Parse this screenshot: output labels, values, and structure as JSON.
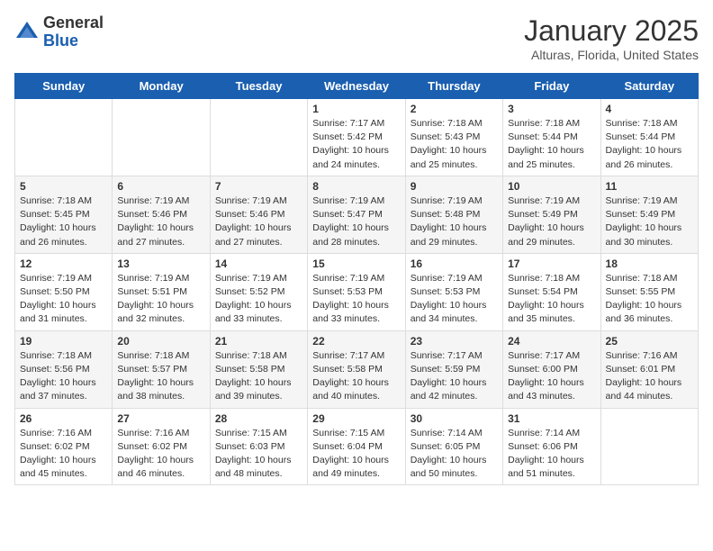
{
  "header": {
    "logo_general": "General",
    "logo_blue": "Blue",
    "title": "January 2025",
    "subtitle": "Alturas, Florida, United States"
  },
  "weekdays": [
    "Sunday",
    "Monday",
    "Tuesday",
    "Wednesday",
    "Thursday",
    "Friday",
    "Saturday"
  ],
  "weeks": [
    [
      {
        "day": "",
        "sunrise": "",
        "sunset": "",
        "daylight": ""
      },
      {
        "day": "",
        "sunrise": "",
        "sunset": "",
        "daylight": ""
      },
      {
        "day": "",
        "sunrise": "",
        "sunset": "",
        "daylight": ""
      },
      {
        "day": "1",
        "sunrise": "Sunrise: 7:17 AM",
        "sunset": "Sunset: 5:42 PM",
        "daylight": "Daylight: 10 hours and 24 minutes."
      },
      {
        "day": "2",
        "sunrise": "Sunrise: 7:18 AM",
        "sunset": "Sunset: 5:43 PM",
        "daylight": "Daylight: 10 hours and 25 minutes."
      },
      {
        "day": "3",
        "sunrise": "Sunrise: 7:18 AM",
        "sunset": "Sunset: 5:44 PM",
        "daylight": "Daylight: 10 hours and 25 minutes."
      },
      {
        "day": "4",
        "sunrise": "Sunrise: 7:18 AM",
        "sunset": "Sunset: 5:44 PM",
        "daylight": "Daylight: 10 hours and 26 minutes."
      }
    ],
    [
      {
        "day": "5",
        "sunrise": "Sunrise: 7:18 AM",
        "sunset": "Sunset: 5:45 PM",
        "daylight": "Daylight: 10 hours and 26 minutes."
      },
      {
        "day": "6",
        "sunrise": "Sunrise: 7:19 AM",
        "sunset": "Sunset: 5:46 PM",
        "daylight": "Daylight: 10 hours and 27 minutes."
      },
      {
        "day": "7",
        "sunrise": "Sunrise: 7:19 AM",
        "sunset": "Sunset: 5:46 PM",
        "daylight": "Daylight: 10 hours and 27 minutes."
      },
      {
        "day": "8",
        "sunrise": "Sunrise: 7:19 AM",
        "sunset": "Sunset: 5:47 PM",
        "daylight": "Daylight: 10 hours and 28 minutes."
      },
      {
        "day": "9",
        "sunrise": "Sunrise: 7:19 AM",
        "sunset": "Sunset: 5:48 PM",
        "daylight": "Daylight: 10 hours and 29 minutes."
      },
      {
        "day": "10",
        "sunrise": "Sunrise: 7:19 AM",
        "sunset": "Sunset: 5:49 PM",
        "daylight": "Daylight: 10 hours and 29 minutes."
      },
      {
        "day": "11",
        "sunrise": "Sunrise: 7:19 AM",
        "sunset": "Sunset: 5:49 PM",
        "daylight": "Daylight: 10 hours and 30 minutes."
      }
    ],
    [
      {
        "day": "12",
        "sunrise": "Sunrise: 7:19 AM",
        "sunset": "Sunset: 5:50 PM",
        "daylight": "Daylight: 10 hours and 31 minutes."
      },
      {
        "day": "13",
        "sunrise": "Sunrise: 7:19 AM",
        "sunset": "Sunset: 5:51 PM",
        "daylight": "Daylight: 10 hours and 32 minutes."
      },
      {
        "day": "14",
        "sunrise": "Sunrise: 7:19 AM",
        "sunset": "Sunset: 5:52 PM",
        "daylight": "Daylight: 10 hours and 33 minutes."
      },
      {
        "day": "15",
        "sunrise": "Sunrise: 7:19 AM",
        "sunset": "Sunset: 5:53 PM",
        "daylight": "Daylight: 10 hours and 33 minutes."
      },
      {
        "day": "16",
        "sunrise": "Sunrise: 7:19 AM",
        "sunset": "Sunset: 5:53 PM",
        "daylight": "Daylight: 10 hours and 34 minutes."
      },
      {
        "day": "17",
        "sunrise": "Sunrise: 7:18 AM",
        "sunset": "Sunset: 5:54 PM",
        "daylight": "Daylight: 10 hours and 35 minutes."
      },
      {
        "day": "18",
        "sunrise": "Sunrise: 7:18 AM",
        "sunset": "Sunset: 5:55 PM",
        "daylight": "Daylight: 10 hours and 36 minutes."
      }
    ],
    [
      {
        "day": "19",
        "sunrise": "Sunrise: 7:18 AM",
        "sunset": "Sunset: 5:56 PM",
        "daylight": "Daylight: 10 hours and 37 minutes."
      },
      {
        "day": "20",
        "sunrise": "Sunrise: 7:18 AM",
        "sunset": "Sunset: 5:57 PM",
        "daylight": "Daylight: 10 hours and 38 minutes."
      },
      {
        "day": "21",
        "sunrise": "Sunrise: 7:18 AM",
        "sunset": "Sunset: 5:58 PM",
        "daylight": "Daylight: 10 hours and 39 minutes."
      },
      {
        "day": "22",
        "sunrise": "Sunrise: 7:17 AM",
        "sunset": "Sunset: 5:58 PM",
        "daylight": "Daylight: 10 hours and 40 minutes."
      },
      {
        "day": "23",
        "sunrise": "Sunrise: 7:17 AM",
        "sunset": "Sunset: 5:59 PM",
        "daylight": "Daylight: 10 hours and 42 minutes."
      },
      {
        "day": "24",
        "sunrise": "Sunrise: 7:17 AM",
        "sunset": "Sunset: 6:00 PM",
        "daylight": "Daylight: 10 hours and 43 minutes."
      },
      {
        "day": "25",
        "sunrise": "Sunrise: 7:16 AM",
        "sunset": "Sunset: 6:01 PM",
        "daylight": "Daylight: 10 hours and 44 minutes."
      }
    ],
    [
      {
        "day": "26",
        "sunrise": "Sunrise: 7:16 AM",
        "sunset": "Sunset: 6:02 PM",
        "daylight": "Daylight: 10 hours and 45 minutes."
      },
      {
        "day": "27",
        "sunrise": "Sunrise: 7:16 AM",
        "sunset": "Sunset: 6:02 PM",
        "daylight": "Daylight: 10 hours and 46 minutes."
      },
      {
        "day": "28",
        "sunrise": "Sunrise: 7:15 AM",
        "sunset": "Sunset: 6:03 PM",
        "daylight": "Daylight: 10 hours and 48 minutes."
      },
      {
        "day": "29",
        "sunrise": "Sunrise: 7:15 AM",
        "sunset": "Sunset: 6:04 PM",
        "daylight": "Daylight: 10 hours and 49 minutes."
      },
      {
        "day": "30",
        "sunrise": "Sunrise: 7:14 AM",
        "sunset": "Sunset: 6:05 PM",
        "daylight": "Daylight: 10 hours and 50 minutes."
      },
      {
        "day": "31",
        "sunrise": "Sunrise: 7:14 AM",
        "sunset": "Sunset: 6:06 PM",
        "daylight": "Daylight: 10 hours and 51 minutes."
      },
      {
        "day": "",
        "sunrise": "",
        "sunset": "",
        "daylight": ""
      }
    ]
  ]
}
